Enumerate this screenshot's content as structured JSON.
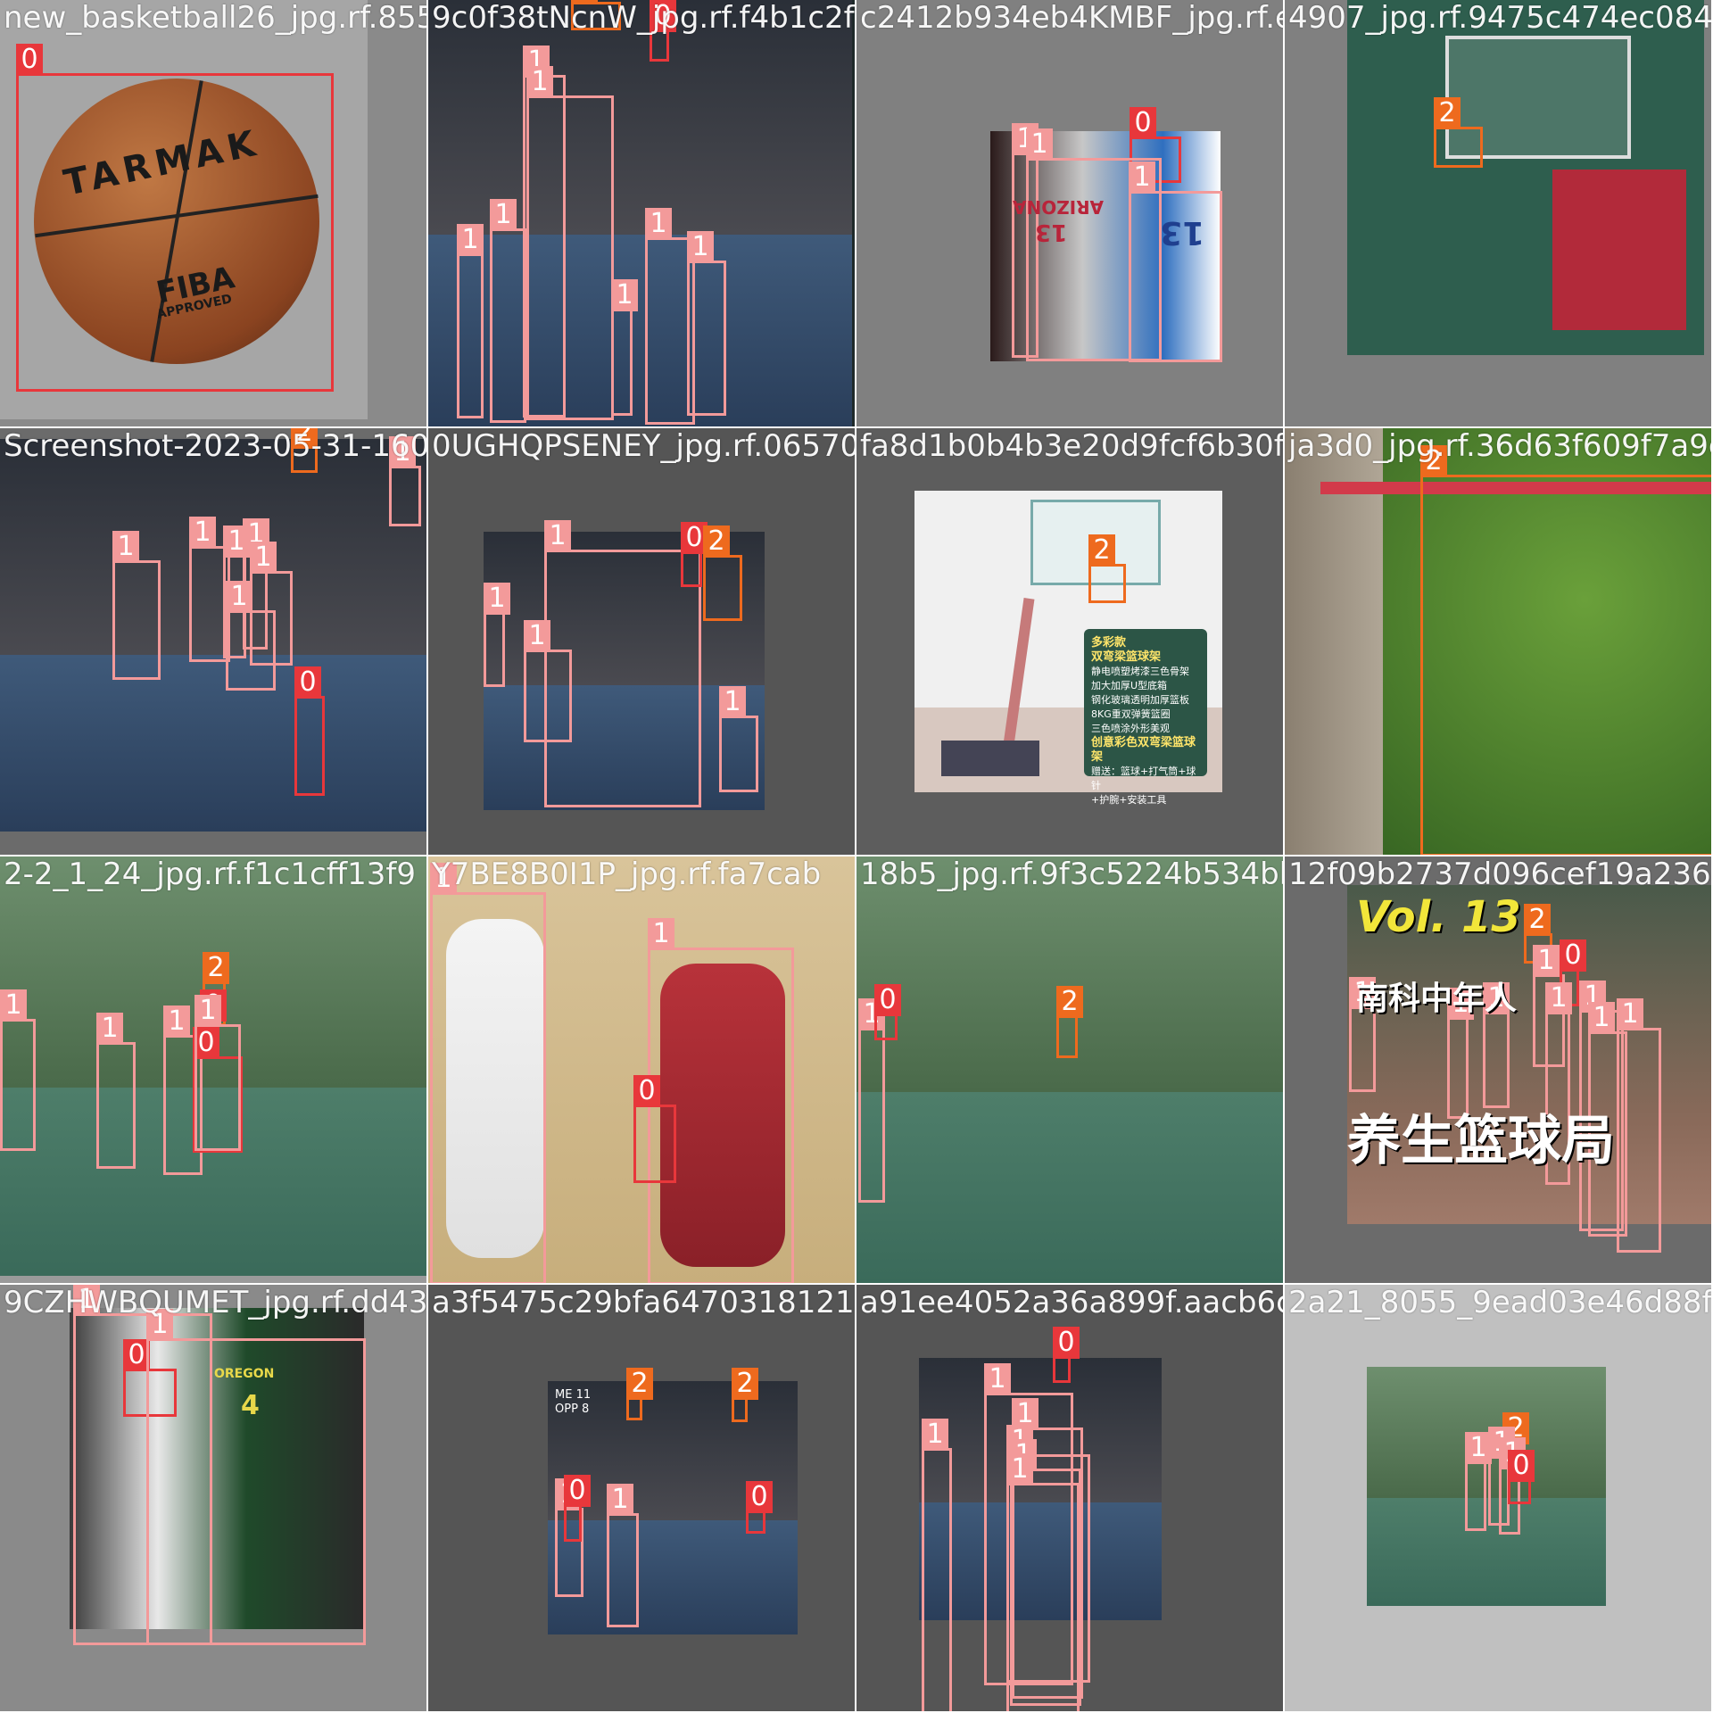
{
  "classes": {
    "0": {
      "label": "0",
      "color": "#e8373b"
    },
    "1": {
      "label": "1",
      "color": "#f39a9a"
    },
    "2": {
      "label": "2",
      "color": "#ee6a1e"
    }
  },
  "tiles": [
    {
      "id": "t1",
      "filename": "new_basketball26_jpg.rf.8559d0f58f7bce7",
      "scene": "ball",
      "ball_text": {
        "brand": "TARMAK",
        "fiba": "FIBA",
        "approved": "APPROVED"
      },
      "boxes": [
        {
          "cls": "0"
        }
      ]
    },
    {
      "id": "t2",
      "filename": "9c0f38tNcnW_jpg.rf.f4b1c2f1f534bf2",
      "scene": "dunk",
      "boxes": [
        {
          "cls": "2"
        },
        {
          "cls": "0"
        },
        {
          "cls": "1"
        },
        {
          "cls": "1"
        },
        {
          "cls": "1"
        },
        {
          "cls": "1"
        },
        {
          "cls": "1"
        },
        {
          "cls": "1"
        },
        {
          "cls": "1"
        }
      ]
    },
    {
      "id": "t3",
      "filename": "c2412b934eb4KMBF_jpg.rf.eb4b49e9",
      "scene": "arizona",
      "jersey": {
        "arizona": "ARIZONA",
        "num1": "13",
        "num2": "13"
      },
      "boxes": [
        {
          "cls": "0"
        },
        {
          "cls": "1"
        },
        {
          "cls": "1"
        },
        {
          "cls": "1"
        }
      ]
    },
    {
      "id": "t4",
      "filename": "4907_jpg.rf.9475c474ec0840e6b8",
      "scene": "hoop_gym",
      "boxes": [
        {
          "cls": "2"
        }
      ]
    },
    {
      "id": "t5",
      "filename": "Screenshot-2023-05-31-160551",
      "scene": "crowd_court",
      "boxes": [
        {
          "cls": "2"
        },
        {
          "cls": "1"
        },
        {
          "cls": "1"
        },
        {
          "cls": "1"
        },
        {
          "cls": "1"
        },
        {
          "cls": "1"
        },
        {
          "cls": "1"
        },
        {
          "cls": "1"
        },
        {
          "cls": "0"
        }
      ]
    },
    {
      "id": "t6",
      "filename": "0UGHQPSENEY_jpg.rf.065708216627b0fa230",
      "scene": "dunk_arena",
      "boxes": [
        {
          "cls": "1"
        },
        {
          "cls": "0"
        },
        {
          "cls": "2"
        },
        {
          "cls": "1"
        },
        {
          "cls": "1"
        },
        {
          "cls": "1"
        }
      ]
    },
    {
      "id": "t7",
      "filename": "fa8d1b0b4b3e20d9fcf6b30f13d0",
      "scene": "hoop_stand",
      "sign": {
        "title": "多彩款",
        "subtitle": "双弯梁篮球架",
        "lines": [
          "静电喷塑烤漆三色骨架",
          "加大加厚U型底箱",
          "钢化玻璃透明加厚篮板",
          "8KG重双弹簧篮圈",
          "三色喷涂外形美观"
        ],
        "highlight": "创意彩色双弯梁篮球架",
        "gifts": [
          "赠送：篮球+打气筒+球针",
          "+护腕+安装工具"
        ]
      },
      "boxes": [
        {
          "cls": "2"
        }
      ]
    },
    {
      "id": "t8",
      "filename": "ja3d0_jpg.rf.36d63f609f7a9d1",
      "scene": "net_closeup",
      "boxes": [
        {
          "cls": "2"
        }
      ]
    },
    {
      "id": "t9",
      "filename": "2-2_1_24_jpg.rf.f1c1cff13f9",
      "scene": "outdoor_court",
      "boxes": [
        {
          "cls": "1"
        },
        {
          "cls": "1"
        },
        {
          "cls": "1"
        },
        {
          "cls": "2"
        },
        {
          "cls": "0"
        },
        {
          "cls": "0"
        },
        {
          "cls": "1"
        }
      ]
    },
    {
      "id": "t10",
      "filename": "Y7BE8B0I1P_jpg.rf.fa7cab",
      "scene": "nba_dribble",
      "boxes": [
        {
          "cls": "1"
        },
        {
          "cls": "1"
        },
        {
          "cls": "0"
        }
      ]
    },
    {
      "id": "t11",
      "filename": "18b5_jpg.rf.9f3c5224b534bb7d2af0",
      "scene": "park_court",
      "boxes": [
        {
          "cls": "1"
        },
        {
          "cls": "0"
        },
        {
          "cls": "2"
        }
      ]
    },
    {
      "id": "t12",
      "filename": "12f09b2737d096cef19a236b",
      "scene": "vol13",
      "overlay": {
        "vol": "Vol. 13",
        "cn1": "南科中年人",
        "cn2": "养生篮球局"
      },
      "boxes": [
        {
          "cls": "2"
        },
        {
          "cls": "1"
        },
        {
          "cls": "0"
        },
        {
          "cls": "1"
        },
        {
          "cls": "1"
        },
        {
          "cls": "1"
        },
        {
          "cls": "1"
        },
        {
          "cls": "1"
        },
        {
          "cls": "1"
        },
        {
          "cls": "1"
        }
      ]
    },
    {
      "id": "t13",
      "filename": "9CZHWBQUMET_jpg.rf.dd433f54e5",
      "scene": "oregon",
      "jersey": {
        "oregon": "OREGON",
        "num": "4"
      },
      "boxes": [
        {
          "cls": "1"
        },
        {
          "cls": "0"
        },
        {
          "cls": "1"
        }
      ]
    },
    {
      "id": "t14",
      "filename": "a3f5475c29bfa6470318121529",
      "scene": "indoor_gym",
      "sign": {
        "me": "ME 11",
        "opp": "OPP 8"
      },
      "boxes": [
        {
          "cls": "2"
        },
        {
          "cls": "2"
        },
        {
          "cls": "1"
        },
        {
          "cls": "0"
        },
        {
          "cls": "1"
        },
        {
          "cls": "0"
        }
      ]
    },
    {
      "id": "t15",
      "filename": "a91ee4052a36a899f.aacb6c612",
      "scene": "indoor_team",
      "boxes": [
        {
          "cls": "0"
        },
        {
          "cls": "1"
        },
        {
          "cls": "1"
        },
        {
          "cls": "1"
        },
        {
          "cls": "1"
        },
        {
          "cls": "1"
        },
        {
          "cls": "1"
        }
      ]
    },
    {
      "id": "t16",
      "filename": "2a21_8055_9ead03e46d88fdb",
      "scene": "far_court",
      "boxes": [
        {
          "cls": "2"
        },
        {
          "cls": "1"
        },
        {
          "cls": "1"
        },
        {
          "cls": "1"
        },
        {
          "cls": "0"
        }
      ]
    }
  ]
}
